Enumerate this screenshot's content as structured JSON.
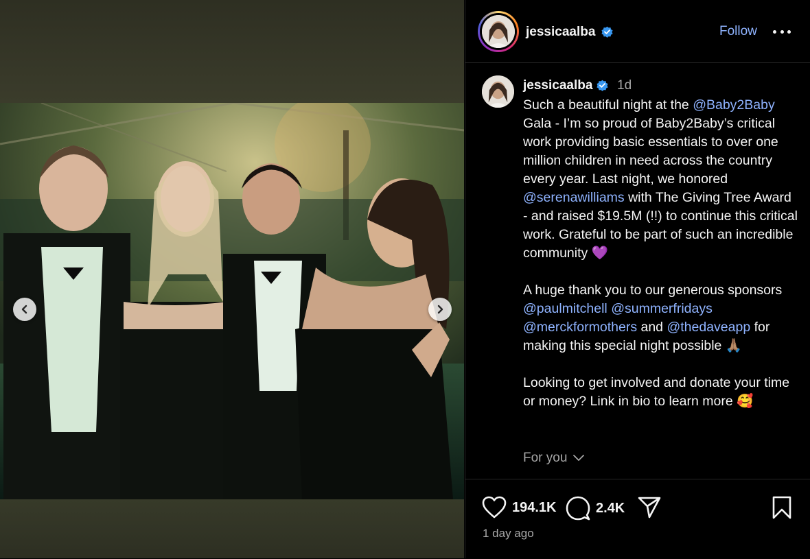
{
  "post": {
    "username": "jessicaalba",
    "follow_label": "Follow",
    "caption_time": "1d",
    "caption_parts": [
      {
        "t": "text",
        "v": "Such a beautiful night at the "
      },
      {
        "t": "mention",
        "v": "@Baby2Baby"
      },
      {
        "t": "text",
        "v": " Gala - I’m so proud of Baby2Baby’s critical work providing basic essentials to over one million children in need across the country every year. Last night, we honored "
      },
      {
        "t": "mention",
        "v": "@serenawilliams"
      },
      {
        "t": "text",
        "v": " with The Giving Tree Award - and raised $19.5M (!!) to continue this critical work. Grateful to be part of such an incredible community 💜\n\nA huge thank you to our generous sponsors "
      },
      {
        "t": "mention",
        "v": "@paulmitchell"
      },
      {
        "t": "text",
        "v": " "
      },
      {
        "t": "mention",
        "v": "@summerfridays"
      },
      {
        "t": "text",
        "v": " "
      },
      {
        "t": "mention",
        "v": "@merckformothers"
      },
      {
        "t": "text",
        "v": " and "
      },
      {
        "t": "mention",
        "v": "@thedaveapp"
      },
      {
        "t": "text",
        "v": " for making this special night possible 🙏🏽\n\nLooking to get involved and donate your time or money? Link in bio to learn more 🥰"
      }
    ],
    "for_you_label": "For you",
    "likes": "194.1K",
    "comments": "2.4K",
    "posted_ago": "1 day ago"
  },
  "icons": {
    "prev": "chevron-left-icon",
    "next": "chevron-right-icon",
    "verified": "verified-badge-icon",
    "more": "more-horizontal-icon",
    "like": "heart-icon",
    "comment": "comment-icon",
    "share": "send-icon",
    "save": "bookmark-icon",
    "for_you_chevron": "chevron-down-icon"
  },
  "colors": {
    "background": "#000000",
    "text": "#f5f5f5",
    "muted": "#a8a8a8",
    "link": "#8fb3ff",
    "verified": "#3897f0",
    "divider": "#262626"
  }
}
